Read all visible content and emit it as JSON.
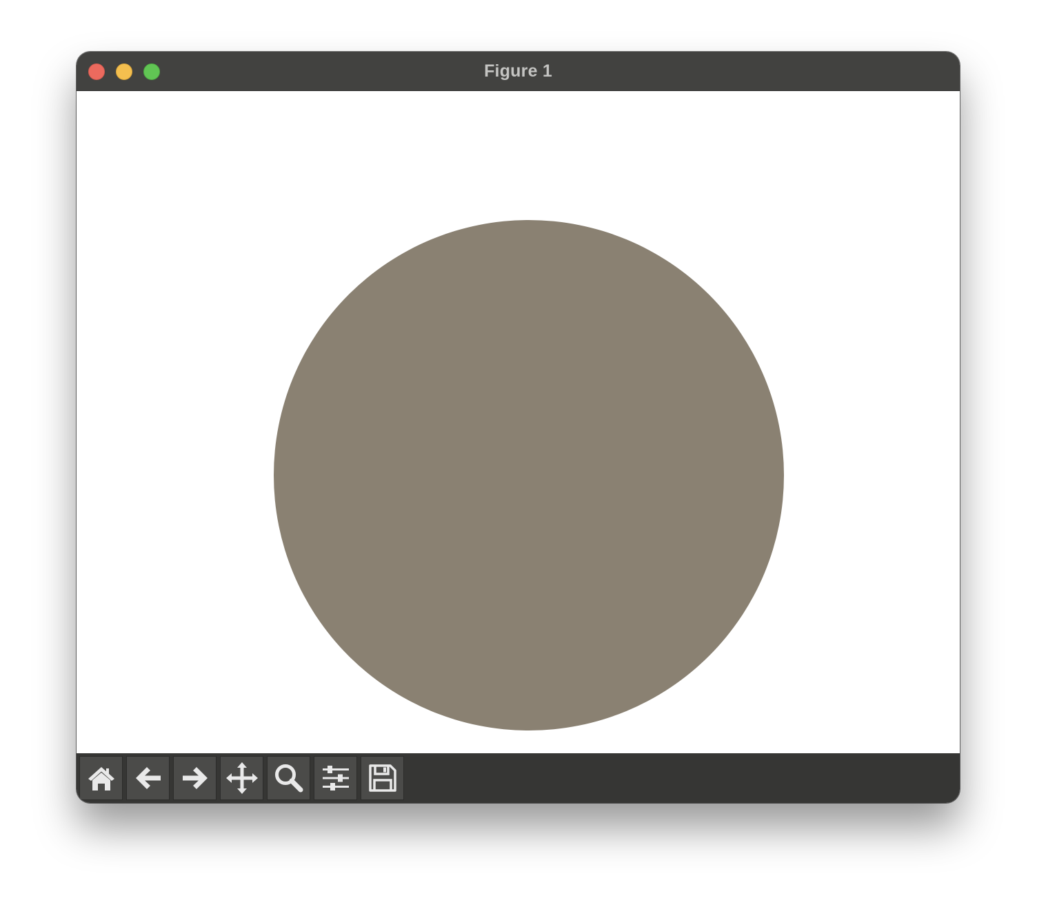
{
  "window": {
    "title": "Figure 1"
  },
  "figure": {
    "shape": "circle",
    "fill_color": "#8a8172",
    "background_color": "#ffffff"
  },
  "toolbar": {
    "buttons": [
      {
        "name": "home",
        "icon": "home-icon"
      },
      {
        "name": "back",
        "icon": "arrow-left-icon"
      },
      {
        "name": "forward",
        "icon": "arrow-right-icon"
      },
      {
        "name": "pan",
        "icon": "move-icon"
      },
      {
        "name": "zoom",
        "icon": "magnifier-icon"
      },
      {
        "name": "configure-subplots",
        "icon": "sliders-icon"
      },
      {
        "name": "save",
        "icon": "floppy-disk-icon"
      }
    ]
  }
}
